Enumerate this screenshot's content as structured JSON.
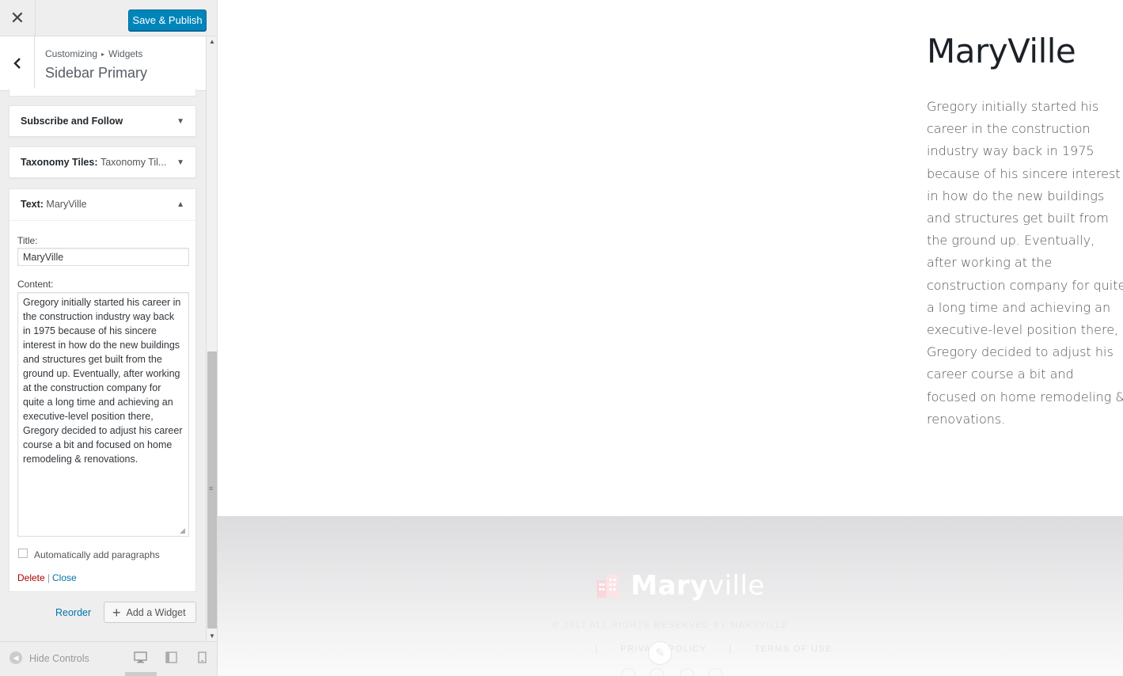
{
  "topbar": {
    "close_glyph": "✕",
    "publish_label": "Save & Publish"
  },
  "section": {
    "breadcrumb_parent": "Customizing",
    "breadcrumb_sep": "▸",
    "breadcrumb_child": "Widgets",
    "title": "Sidebar Primary"
  },
  "widgets": [
    {
      "title": "Subscribe and Follow",
      "subtitle": "",
      "expanded": false
    },
    {
      "title": "Taxonomy Tiles:",
      "subtitle": "Taxonomy Til...",
      "expanded": false
    },
    {
      "title": "Text:",
      "subtitle": "MaryVille",
      "expanded": true
    }
  ],
  "form": {
    "title_label": "Title:",
    "title_value": "MaryVille",
    "content_label": "Content:",
    "content_value": "Gregory initially started his career in the construction industry way back in 1975 because of his sincere interest in how do the new buildings and structures get built from the ground up. Eventually, after working at the construction company for quite a long time and achieving an executive-level position there, Gregory decided to adjust his career course a bit and focused on home remodeling & renovations.",
    "auto_paragraphs_label": "Automatically add paragraphs",
    "auto_paragraphs_checked": false,
    "delete_label": "Delete",
    "separator": "|",
    "close_label": "Close"
  },
  "actions": {
    "reorder_label": "Reorder",
    "add_widget_label": "Add a Widget"
  },
  "footer_controls": {
    "hide_label": "Hide Controls",
    "active_device": "desktop"
  },
  "preview": {
    "widget_title": "MaryVille",
    "widget_text": "Gregory initially started his career in the construction industry way back in 1975 because of his sincere interest in how do the new buildings and structures get built from the ground up. Eventually, after working at the construction company for quite a long time and achieving an executive-level position there, Gregory decided to adjust his career course a bit and focused on home remodeling & renovations.",
    "footer": {
      "brand_bold": "Mary",
      "brand_light": "ville",
      "copyright": "© 2017 ALL RIGHTS RESERVED BY MARYVILLE",
      "links": [
        "PRIVACY POLICY",
        "TERMS OF USE"
      ],
      "link_sep": "|"
    }
  },
  "colors": {
    "publish": "#0085ba",
    "link": "#0073aa",
    "delete": "#a00",
    "logo_icon": "#f7d7dc"
  }
}
